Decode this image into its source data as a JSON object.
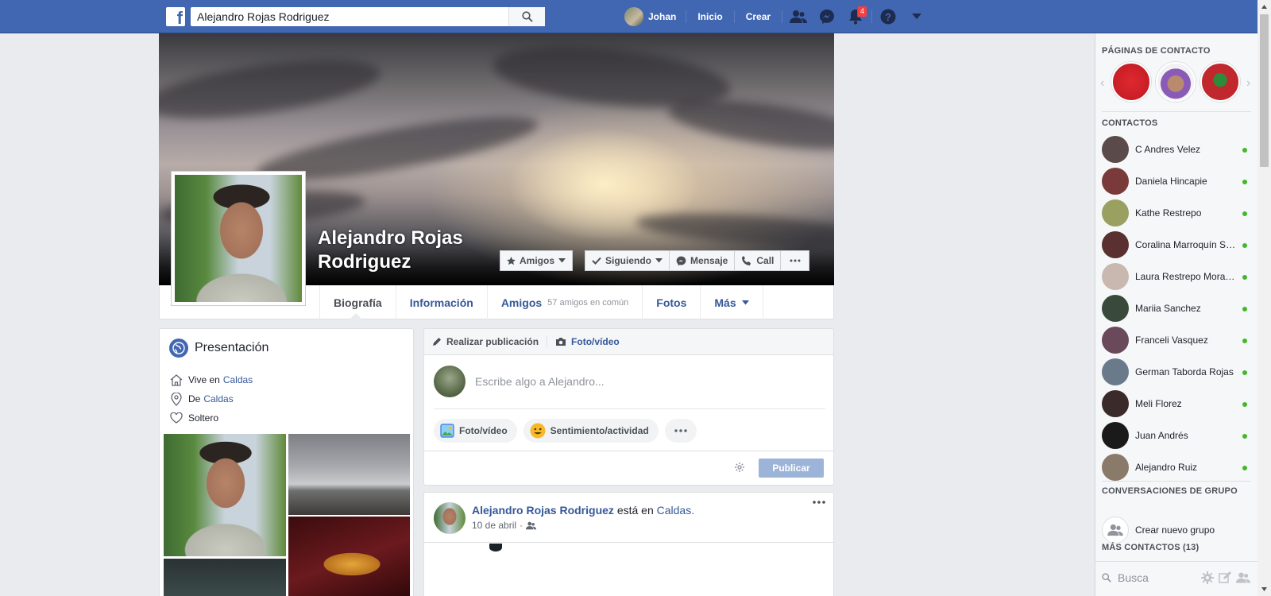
{
  "topbar": {
    "search_value": "Alejandro Rojas Rodriguez",
    "user_name": "Johan",
    "home_label": "Inicio",
    "create_label": "Crear",
    "notifications_count": "4",
    "logo_letter": "f"
  },
  "profile": {
    "name": "Alejandro Rojas Rodriguez",
    "buttons": {
      "friends": "Amigos",
      "following": "Siguiendo",
      "message": "Mensaje",
      "call": "Call"
    },
    "tabs": {
      "timeline": "Biografía",
      "about": "Información",
      "friends": "Amigos",
      "friends_sub": "57 amigos en común",
      "photos": "Fotos",
      "more": "Más"
    }
  },
  "intro": {
    "title": "Presentación",
    "lives_prefix": "Vive en",
    "lives_place": "Caldas",
    "from_prefix": "De",
    "from_place": "Caldas",
    "relationship": "Soltero"
  },
  "composer": {
    "tab_post": "Realizar publicación",
    "tab_photo": "Foto/vídeo",
    "placeholder": "Escribe algo a Alejandro...",
    "chip_photo": "Foto/vídeo",
    "chip_feeling": "Sentimiento/actividad",
    "publish": "Publicar"
  },
  "post": {
    "author": "Alejandro Rojas Rodriguez",
    "verb": "está en",
    "place": "Caldas.",
    "date": "10 de abril"
  },
  "sidebar": {
    "pages_title": "PÁGINAS DE CONTACTO",
    "contacts_title": "CONTACTOS",
    "contacts": [
      {
        "name": "C Andres Velez",
        "color": "#5a4a4a"
      },
      {
        "name": "Daniela Hincapie",
        "color": "#7a3a3a"
      },
      {
        "name": "Kathe Restrepo",
        "color": "#9aa060"
      },
      {
        "name": "Coralina Marroquín Sánchez",
        "color": "#5a3030"
      },
      {
        "name": "Laura Restrepo Morales",
        "color": "#c8b8b0"
      },
      {
        "name": "Mariia Sanchez",
        "color": "#3a4a3a"
      },
      {
        "name": "Franceli Vasquez",
        "color": "#6a4a5a"
      },
      {
        "name": "German Taborda Rojas",
        "color": "#6a7a8a"
      },
      {
        "name": "Meli Florez",
        "color": "#3a2a2a"
      },
      {
        "name": "Juan Andrés",
        "color": "#1a1a1a"
      },
      {
        "name": "Alejandro Ruiz",
        "color": "#8a7a6a"
      }
    ],
    "groups_title": "CONVERSACIONES DE GRUPO",
    "create_group": "Crear nuevo grupo",
    "more_contacts": "MÁS CONTACTOS (13)",
    "search_placeholder": "Busca"
  }
}
